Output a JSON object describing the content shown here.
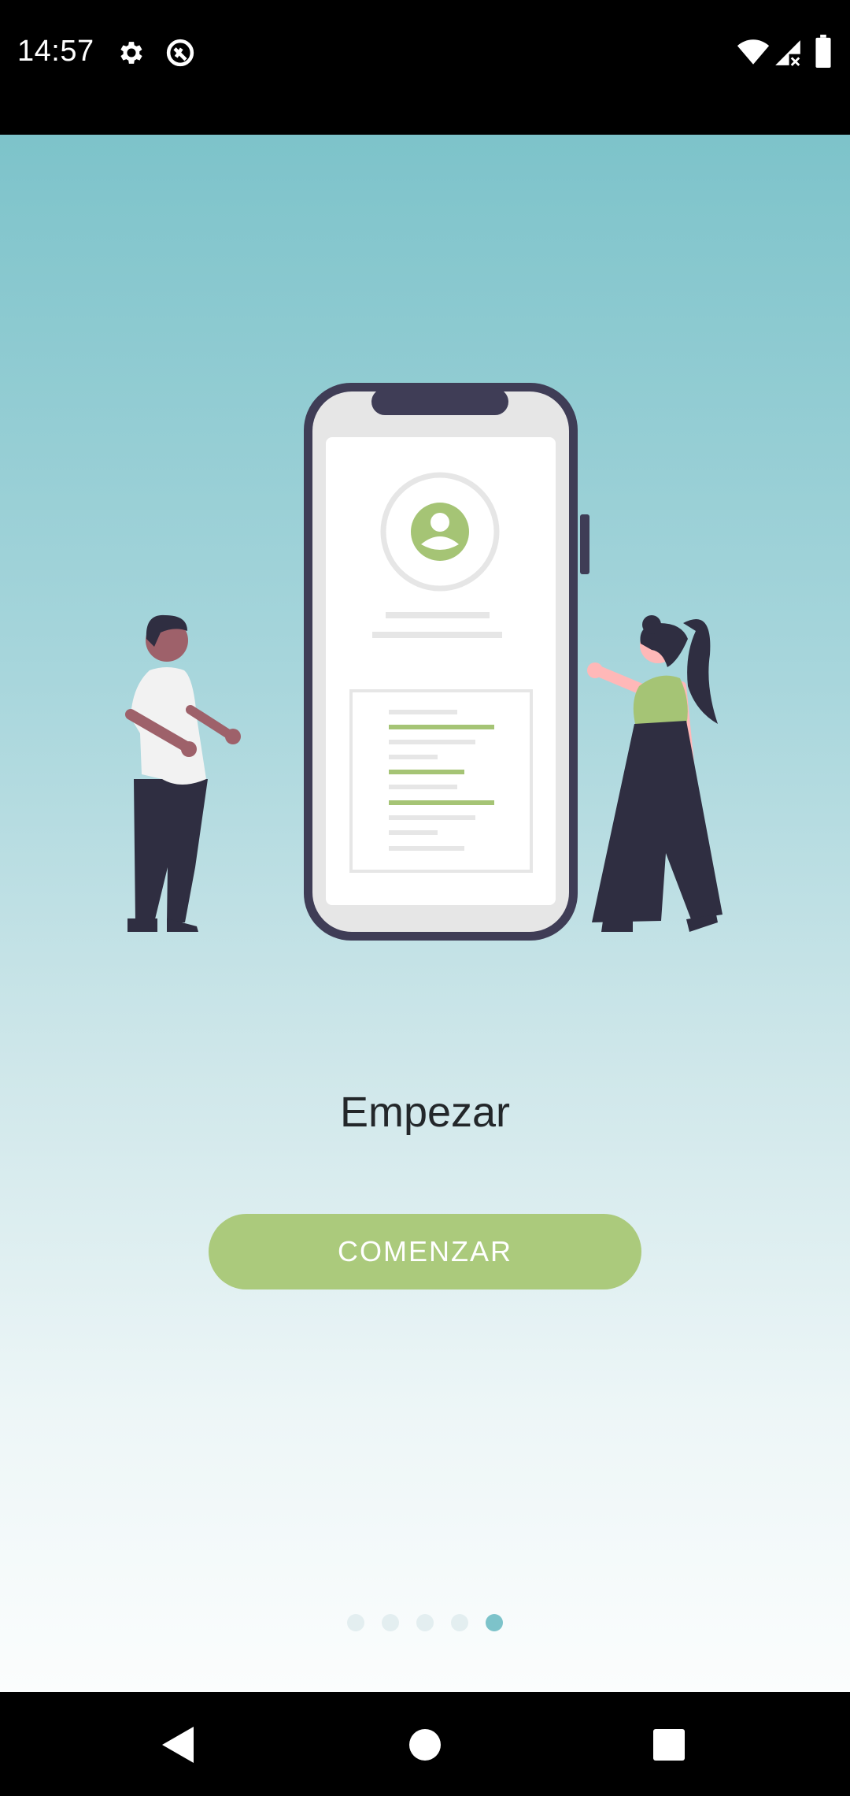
{
  "status_bar": {
    "time": "14:57",
    "icons": [
      "gear-icon",
      "sync-disabled-icon",
      "wifi-icon",
      "cell-signal-icon",
      "battery-icon"
    ]
  },
  "onboarding": {
    "title": "Empezar",
    "button_label": "COMENZAR",
    "page_count": 5,
    "current_page": 5
  },
  "navigation_bar": {
    "buttons": [
      "back-icon",
      "home-icon",
      "recents-icon"
    ]
  },
  "colors": {
    "accent_green": "#abca7c",
    "gradient_top": "#7dc3ca",
    "gradient_bottom": "#fbfdfd",
    "active_dot": "#7dc3ca"
  }
}
